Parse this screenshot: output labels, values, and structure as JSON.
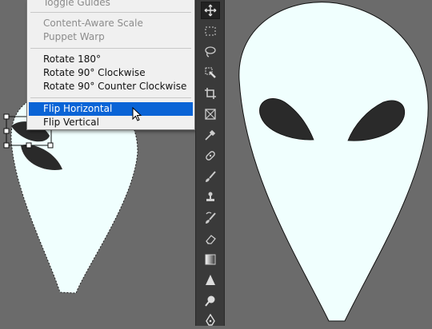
{
  "menu": {
    "items": {
      "toggle_guides": "Toggle Guides",
      "content_aware_scale": "Content-Aware Scale",
      "puppet_warp": "Puppet Warp",
      "rotate_180": "Rotate 180°",
      "rotate_90_cw": "Rotate 90° Clockwise",
      "rotate_90_ccw": "Rotate 90° Counter Clockwise",
      "flip_horizontal": "Flip Horizontal",
      "flip_vertical": "Flip Vertical"
    },
    "highlighted": "flip_horizontal",
    "highlight_color": "#0a64d6"
  },
  "toolbar": {
    "tools": [
      "move-icon",
      "marquee-icon",
      "lasso-icon",
      "quick-selection-icon",
      "crop-icon",
      "frame-icon",
      "eyedropper-icon",
      "spot-healing-icon",
      "brush-icon",
      "clone-stamp-icon",
      "history-brush-icon",
      "eraser-icon",
      "gradient-icon",
      "sharpen-icon",
      "dodge-icon",
      "pen-icon"
    ],
    "active_tool": "move-icon"
  },
  "colors": {
    "canvas_bg": "#6b6b6b",
    "face_fill": "#f0fffe",
    "eye_fill": "#2a2a2a",
    "toolbar_bg": "#3a3a3a"
  }
}
